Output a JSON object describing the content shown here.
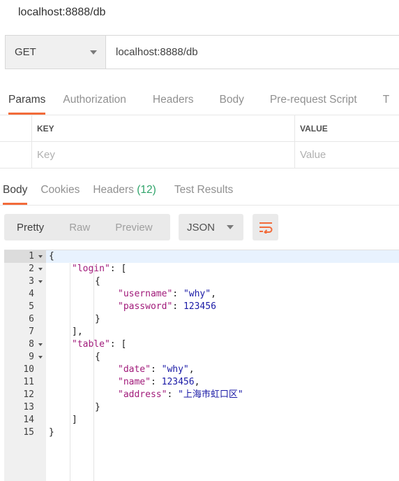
{
  "request": {
    "title": "localhost:8888/db",
    "method": "GET",
    "url": "localhost:8888/db"
  },
  "request_tabs": [
    {
      "label": "Params",
      "active": true
    },
    {
      "label": "Authorization"
    },
    {
      "label": "Headers"
    },
    {
      "label": "Body"
    },
    {
      "label": "Pre-request Script"
    },
    {
      "label": "T"
    }
  ],
  "params": {
    "key_header": "KEY",
    "value_header": "VALUE",
    "key_placeholder": "Key",
    "value_placeholder": "Value"
  },
  "response_tabs": [
    {
      "label": "Body",
      "active": true
    },
    {
      "label": "Cookies"
    },
    {
      "label": "Headers",
      "count": "(12)"
    },
    {
      "label": "Test Results"
    }
  ],
  "view_modes": [
    "Pretty",
    "Raw",
    "Preview"
  ],
  "active_view": "Pretty",
  "format": "JSON",
  "icons": {
    "method_dropdown": "chevron-down-icon",
    "format_dropdown": "chevron-down-icon",
    "wrap": "wrap-lines-icon",
    "fold": "fold-arrow-icon"
  },
  "colors": {
    "accent": "#f26b3a",
    "count": "#2fa46a",
    "json_key": "#a11a7a",
    "json_value": "#1a1aa6"
  },
  "code_lines": [
    {
      "num": "1",
      "fold": true,
      "depth": 0,
      "tokens": [
        {
          "t": "{",
          "c": "p"
        }
      ]
    },
    {
      "num": "2",
      "fold": true,
      "depth": 1,
      "tokens": [
        {
          "t": "\"login\"",
          "c": "k"
        },
        {
          "t": ": [",
          "c": "p"
        }
      ]
    },
    {
      "num": "3",
      "fold": true,
      "depth": 2,
      "tokens": [
        {
          "t": "{",
          "c": "p"
        }
      ]
    },
    {
      "num": "4",
      "fold": false,
      "depth": 3,
      "tokens": [
        {
          "t": "\"username\"",
          "c": "k"
        },
        {
          "t": ": ",
          "c": "p"
        },
        {
          "t": "\"why\"",
          "c": "s"
        },
        {
          "t": ",",
          "c": "p"
        }
      ]
    },
    {
      "num": "5",
      "fold": false,
      "depth": 3,
      "tokens": [
        {
          "t": "\"password\"",
          "c": "k"
        },
        {
          "t": ": ",
          "c": "p"
        },
        {
          "t": "123456",
          "c": "n"
        }
      ]
    },
    {
      "num": "6",
      "fold": false,
      "depth": 2,
      "tokens": [
        {
          "t": "}",
          "c": "p"
        }
      ]
    },
    {
      "num": "7",
      "fold": false,
      "depth": 1,
      "tokens": [
        {
          "t": "],",
          "c": "p"
        }
      ]
    },
    {
      "num": "8",
      "fold": true,
      "depth": 1,
      "tokens": [
        {
          "t": "\"table\"",
          "c": "k"
        },
        {
          "t": ": [",
          "c": "p"
        }
      ]
    },
    {
      "num": "9",
      "fold": true,
      "depth": 2,
      "tokens": [
        {
          "t": "{",
          "c": "p"
        }
      ]
    },
    {
      "num": "10",
      "fold": false,
      "depth": 3,
      "tokens": [
        {
          "t": "\"date\"",
          "c": "k"
        },
        {
          "t": ": ",
          "c": "p"
        },
        {
          "t": "\"why\"",
          "c": "s"
        },
        {
          "t": ",",
          "c": "p"
        }
      ]
    },
    {
      "num": "11",
      "fold": false,
      "depth": 3,
      "tokens": [
        {
          "t": "\"name\"",
          "c": "k"
        },
        {
          "t": ": ",
          "c": "p"
        },
        {
          "t": "123456",
          "c": "n"
        },
        {
          "t": ",",
          "c": "p"
        }
      ]
    },
    {
      "num": "12",
      "fold": false,
      "depth": 3,
      "tokens": [
        {
          "t": "\"address\"",
          "c": "k"
        },
        {
          "t": ": ",
          "c": "p"
        },
        {
          "t": "\"上海市虹口区\"",
          "c": "s"
        }
      ]
    },
    {
      "num": "13",
      "fold": false,
      "depth": 2,
      "tokens": [
        {
          "t": "}",
          "c": "p"
        }
      ]
    },
    {
      "num": "14",
      "fold": false,
      "depth": 1,
      "tokens": [
        {
          "t": "]",
          "c": "p"
        }
      ]
    },
    {
      "num": "15",
      "fold": false,
      "depth": 0,
      "tokens": [
        {
          "t": "}",
          "c": "p"
        }
      ]
    }
  ]
}
